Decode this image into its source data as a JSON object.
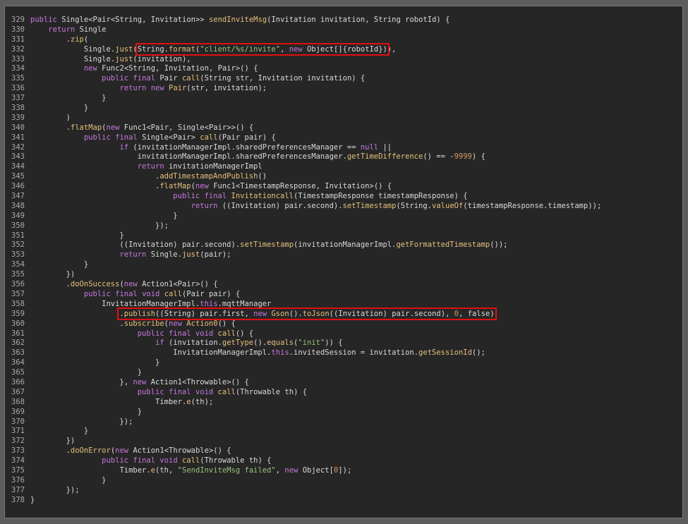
{
  "editor": {
    "lines": [
      {
        "n": "329",
        "t": "public Single<Pair<String, Invitation>> sendInviteMsg(Invitation invitation, String robotId) {"
      },
      {
        "n": "330",
        "t": "    return Single"
      },
      {
        "n": "331",
        "t": "        .zip("
      },
      {
        "n": "332",
        "t": "            Single.just(String.format(\"client/%s/invite\", new Object[]{robotId})),"
      },
      {
        "n": "333",
        "t": "            Single.just(invitation),"
      },
      {
        "n": "334",
        "t": "            new Func2<String, Invitation, Pair>() {"
      },
      {
        "n": "335",
        "t": "                public final Pair call(String str, Invitation invitation) {"
      },
      {
        "n": "336",
        "t": "                    return new Pair(str, invitation);"
      },
      {
        "n": "337",
        "t": "                }"
      },
      {
        "n": "338",
        "t": "            }"
      },
      {
        "n": "339",
        "t": "        )"
      },
      {
        "n": "340",
        "t": "        .flatMap(new Func1<Pair, Single<Pair>>() {"
      },
      {
        "n": "341",
        "t": "            public final Single<Pair> call(Pair pair) {"
      },
      {
        "n": "342",
        "t": "                    if (invitationManagerImpl.sharedPreferencesManager == null ||"
      },
      {
        "n": "343",
        "t": "                        invitationManagerImpl.sharedPreferencesManager.getTimeDifference() == -9999) {"
      },
      {
        "n": "344",
        "t": "                        return invitationManagerImpl"
      },
      {
        "n": "345",
        "t": "                            .addTimestampAndPublish()"
      },
      {
        "n": "346",
        "t": "                            .flatMap(new Func1<TimestampResponse, Invitation>() {"
      },
      {
        "n": "347",
        "t": "                                public final Invitationcall(TimestampResponse timestampResponse) {"
      },
      {
        "n": "348",
        "t": "                                    return ((Invitation) pair.second).setTimestamp(String.valueOf(timestampResponse.timestamp));"
      },
      {
        "n": "349",
        "t": "                                }"
      },
      {
        "n": "350",
        "t": "                            });"
      },
      {
        "n": "351",
        "t": "                    }"
      },
      {
        "n": "352",
        "t": "                    ((Invitation) pair.second).setTimestamp(invitationManagerImpl.getFormattedTimestamp());"
      },
      {
        "n": "353",
        "t": "                    return Single.just(pair);"
      },
      {
        "n": "354",
        "t": "            }"
      },
      {
        "n": "355",
        "t": "        })"
      },
      {
        "n": "356",
        "t": "        .doOnSuccess(new Action1<Pair>() {"
      },
      {
        "n": "357",
        "t": "            public final void call(Pair pair) {"
      },
      {
        "n": "358",
        "t": "                InvitationManagerImpl.this.mqttManager"
      },
      {
        "n": "359",
        "t": "                    .publish((String) pair.first, new Gson().toJson((Invitation) pair.second), 0, false)"
      },
      {
        "n": "360",
        "t": "                    .subscribe(new Action0() {"
      },
      {
        "n": "361",
        "t": "                        public final void call() {"
      },
      {
        "n": "362",
        "t": "                            if (invitation.getType().equals(\"init\")) {"
      },
      {
        "n": "363",
        "t": "                                InvitationManagerImpl.this.invitedSession = invitation.getSessionId();"
      },
      {
        "n": "364",
        "t": "                            }"
      },
      {
        "n": "365",
        "t": "                        }"
      },
      {
        "n": "366",
        "t": "                    }, new Action1<Throwable>() {"
      },
      {
        "n": "367",
        "t": "                        public final void call(Throwable th) {"
      },
      {
        "n": "368",
        "t": "                            Timber.e(th);"
      },
      {
        "n": "369",
        "t": "                        }"
      },
      {
        "n": "370",
        "t": "                    });"
      },
      {
        "n": "371",
        "t": "            }"
      },
      {
        "n": "372",
        "t": "        })"
      },
      {
        "n": "373",
        "t": "        .doOnError(new Action1<Throwable>() {"
      },
      {
        "n": "374",
        "t": "                public final void call(Throwable th) {"
      },
      {
        "n": "375",
        "t": "                    Timber.e(th, \"SendInviteMsg failed\", new Object[0]);"
      },
      {
        "n": "376",
        "t": "                }"
      },
      {
        "n": "377",
        "t": "        });"
      },
      {
        "n": "378",
        "t": "}"
      }
    ],
    "highlights": [
      {
        "line": "332",
        "text": "String.format(\"client/%s/invite\", new Object[]{robotId})"
      },
      {
        "line": "359",
        "text": ".publish((String) pair.first, new Gson().toJson((Invitation) pair.second), 0, false)"
      }
    ],
    "colors": {
      "background": "#262626",
      "highlight_box": "#e01010",
      "keyword": "#c678dd",
      "method": "#e5c07b",
      "string": "#98c379",
      "number": "#d19a66"
    }
  }
}
